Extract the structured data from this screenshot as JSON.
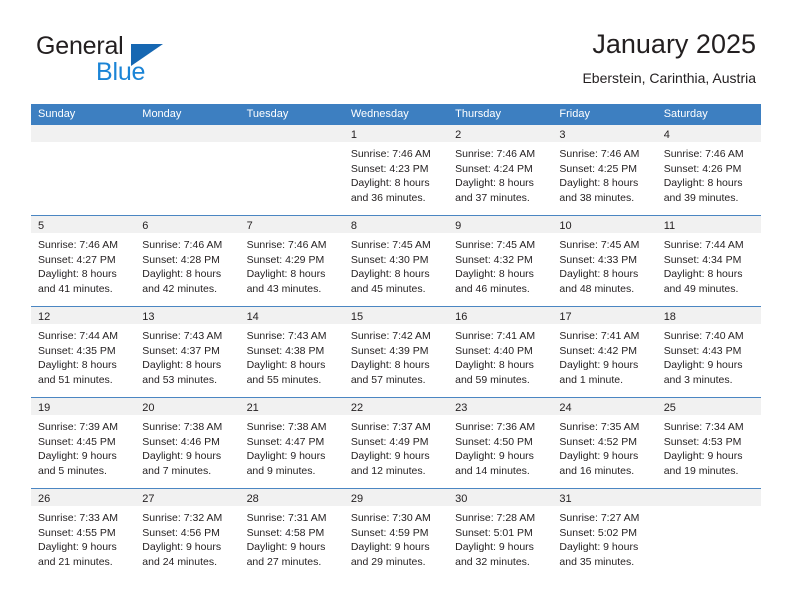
{
  "brand": {
    "line1": "General",
    "line2": "Blue",
    "accent_dark": "#1667b2",
    "accent_light": "#1b84d6"
  },
  "header": {
    "title": "January 2025",
    "subtitle": "Eberstein, Carinthia, Austria"
  },
  "theme": {
    "header_bar": "#3d7fc1",
    "row_divider": "#4b86c2",
    "day_strip": "#f1f1f1",
    "text": "#231f20"
  },
  "calendar": {
    "day_headers": [
      "Sunday",
      "Monday",
      "Tuesday",
      "Wednesday",
      "Thursday",
      "Friday",
      "Saturday"
    ],
    "weeks": [
      [
        {
          "day": "",
          "sunrise": "",
          "sunset": "",
          "daylight1": "",
          "daylight2": ""
        },
        {
          "day": "",
          "sunrise": "",
          "sunset": "",
          "daylight1": "",
          "daylight2": ""
        },
        {
          "day": "",
          "sunrise": "",
          "sunset": "",
          "daylight1": "",
          "daylight2": ""
        },
        {
          "day": "1",
          "sunrise": "Sunrise: 7:46 AM",
          "sunset": "Sunset: 4:23 PM",
          "daylight1": "Daylight: 8 hours",
          "daylight2": "and 36 minutes."
        },
        {
          "day": "2",
          "sunrise": "Sunrise: 7:46 AM",
          "sunset": "Sunset: 4:24 PM",
          "daylight1": "Daylight: 8 hours",
          "daylight2": "and 37 minutes."
        },
        {
          "day": "3",
          "sunrise": "Sunrise: 7:46 AM",
          "sunset": "Sunset: 4:25 PM",
          "daylight1": "Daylight: 8 hours",
          "daylight2": "and 38 minutes."
        },
        {
          "day": "4",
          "sunrise": "Sunrise: 7:46 AM",
          "sunset": "Sunset: 4:26 PM",
          "daylight1": "Daylight: 8 hours",
          "daylight2": "and 39 minutes."
        }
      ],
      [
        {
          "day": "5",
          "sunrise": "Sunrise: 7:46 AM",
          "sunset": "Sunset: 4:27 PM",
          "daylight1": "Daylight: 8 hours",
          "daylight2": "and 41 minutes."
        },
        {
          "day": "6",
          "sunrise": "Sunrise: 7:46 AM",
          "sunset": "Sunset: 4:28 PM",
          "daylight1": "Daylight: 8 hours",
          "daylight2": "and 42 minutes."
        },
        {
          "day": "7",
          "sunrise": "Sunrise: 7:46 AM",
          "sunset": "Sunset: 4:29 PM",
          "daylight1": "Daylight: 8 hours",
          "daylight2": "and 43 minutes."
        },
        {
          "day": "8",
          "sunrise": "Sunrise: 7:45 AM",
          "sunset": "Sunset: 4:30 PM",
          "daylight1": "Daylight: 8 hours",
          "daylight2": "and 45 minutes."
        },
        {
          "day": "9",
          "sunrise": "Sunrise: 7:45 AM",
          "sunset": "Sunset: 4:32 PM",
          "daylight1": "Daylight: 8 hours",
          "daylight2": "and 46 minutes."
        },
        {
          "day": "10",
          "sunrise": "Sunrise: 7:45 AM",
          "sunset": "Sunset: 4:33 PM",
          "daylight1": "Daylight: 8 hours",
          "daylight2": "and 48 minutes."
        },
        {
          "day": "11",
          "sunrise": "Sunrise: 7:44 AM",
          "sunset": "Sunset: 4:34 PM",
          "daylight1": "Daylight: 8 hours",
          "daylight2": "and 49 minutes."
        }
      ],
      [
        {
          "day": "12",
          "sunrise": "Sunrise: 7:44 AM",
          "sunset": "Sunset: 4:35 PM",
          "daylight1": "Daylight: 8 hours",
          "daylight2": "and 51 minutes."
        },
        {
          "day": "13",
          "sunrise": "Sunrise: 7:43 AM",
          "sunset": "Sunset: 4:37 PM",
          "daylight1": "Daylight: 8 hours",
          "daylight2": "and 53 minutes."
        },
        {
          "day": "14",
          "sunrise": "Sunrise: 7:43 AM",
          "sunset": "Sunset: 4:38 PM",
          "daylight1": "Daylight: 8 hours",
          "daylight2": "and 55 minutes."
        },
        {
          "day": "15",
          "sunrise": "Sunrise: 7:42 AM",
          "sunset": "Sunset: 4:39 PM",
          "daylight1": "Daylight: 8 hours",
          "daylight2": "and 57 minutes."
        },
        {
          "day": "16",
          "sunrise": "Sunrise: 7:41 AM",
          "sunset": "Sunset: 4:40 PM",
          "daylight1": "Daylight: 8 hours",
          "daylight2": "and 59 minutes."
        },
        {
          "day": "17",
          "sunrise": "Sunrise: 7:41 AM",
          "sunset": "Sunset: 4:42 PM",
          "daylight1": "Daylight: 9 hours",
          "daylight2": "and 1 minute."
        },
        {
          "day": "18",
          "sunrise": "Sunrise: 7:40 AM",
          "sunset": "Sunset: 4:43 PM",
          "daylight1": "Daylight: 9 hours",
          "daylight2": "and 3 minutes."
        }
      ],
      [
        {
          "day": "19",
          "sunrise": "Sunrise: 7:39 AM",
          "sunset": "Sunset: 4:45 PM",
          "daylight1": "Daylight: 9 hours",
          "daylight2": "and 5 minutes."
        },
        {
          "day": "20",
          "sunrise": "Sunrise: 7:38 AM",
          "sunset": "Sunset: 4:46 PM",
          "daylight1": "Daylight: 9 hours",
          "daylight2": "and 7 minutes."
        },
        {
          "day": "21",
          "sunrise": "Sunrise: 7:38 AM",
          "sunset": "Sunset: 4:47 PM",
          "daylight1": "Daylight: 9 hours",
          "daylight2": "and 9 minutes."
        },
        {
          "day": "22",
          "sunrise": "Sunrise: 7:37 AM",
          "sunset": "Sunset: 4:49 PM",
          "daylight1": "Daylight: 9 hours",
          "daylight2": "and 12 minutes."
        },
        {
          "day": "23",
          "sunrise": "Sunrise: 7:36 AM",
          "sunset": "Sunset: 4:50 PM",
          "daylight1": "Daylight: 9 hours",
          "daylight2": "and 14 minutes."
        },
        {
          "day": "24",
          "sunrise": "Sunrise: 7:35 AM",
          "sunset": "Sunset: 4:52 PM",
          "daylight1": "Daylight: 9 hours",
          "daylight2": "and 16 minutes."
        },
        {
          "day": "25",
          "sunrise": "Sunrise: 7:34 AM",
          "sunset": "Sunset: 4:53 PM",
          "daylight1": "Daylight: 9 hours",
          "daylight2": "and 19 minutes."
        }
      ],
      [
        {
          "day": "26",
          "sunrise": "Sunrise: 7:33 AM",
          "sunset": "Sunset: 4:55 PM",
          "daylight1": "Daylight: 9 hours",
          "daylight2": "and 21 minutes."
        },
        {
          "day": "27",
          "sunrise": "Sunrise: 7:32 AM",
          "sunset": "Sunset: 4:56 PM",
          "daylight1": "Daylight: 9 hours",
          "daylight2": "and 24 minutes."
        },
        {
          "day": "28",
          "sunrise": "Sunrise: 7:31 AM",
          "sunset": "Sunset: 4:58 PM",
          "daylight1": "Daylight: 9 hours",
          "daylight2": "and 27 minutes."
        },
        {
          "day": "29",
          "sunrise": "Sunrise: 7:30 AM",
          "sunset": "Sunset: 4:59 PM",
          "daylight1": "Daylight: 9 hours",
          "daylight2": "and 29 minutes."
        },
        {
          "day": "30",
          "sunrise": "Sunrise: 7:28 AM",
          "sunset": "Sunset: 5:01 PM",
          "daylight1": "Daylight: 9 hours",
          "daylight2": "and 32 minutes."
        },
        {
          "day": "31",
          "sunrise": "Sunrise: 7:27 AM",
          "sunset": "Sunset: 5:02 PM",
          "daylight1": "Daylight: 9 hours",
          "daylight2": "and 35 minutes."
        },
        {
          "day": "",
          "sunrise": "",
          "sunset": "",
          "daylight1": "",
          "daylight2": ""
        }
      ]
    ]
  }
}
